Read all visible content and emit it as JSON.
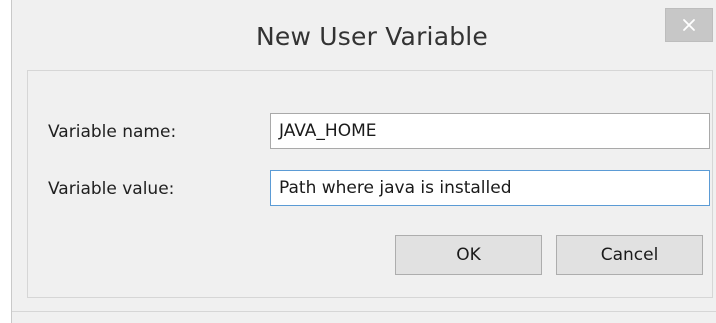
{
  "dialog": {
    "title": "New User Variable",
    "close_icon": "close-icon"
  },
  "form": {
    "name_label": "Variable name:",
    "name_value": "JAVA_HOME",
    "value_label": "Variable value:",
    "value_value": "Path where java is installed"
  },
  "buttons": {
    "ok_label": "OK",
    "cancel_label": "Cancel"
  },
  "colors": {
    "focus_border": "#5b9bd5",
    "close_button_bg": "#c7c7c7",
    "window_bg": "#f0f0f0"
  }
}
